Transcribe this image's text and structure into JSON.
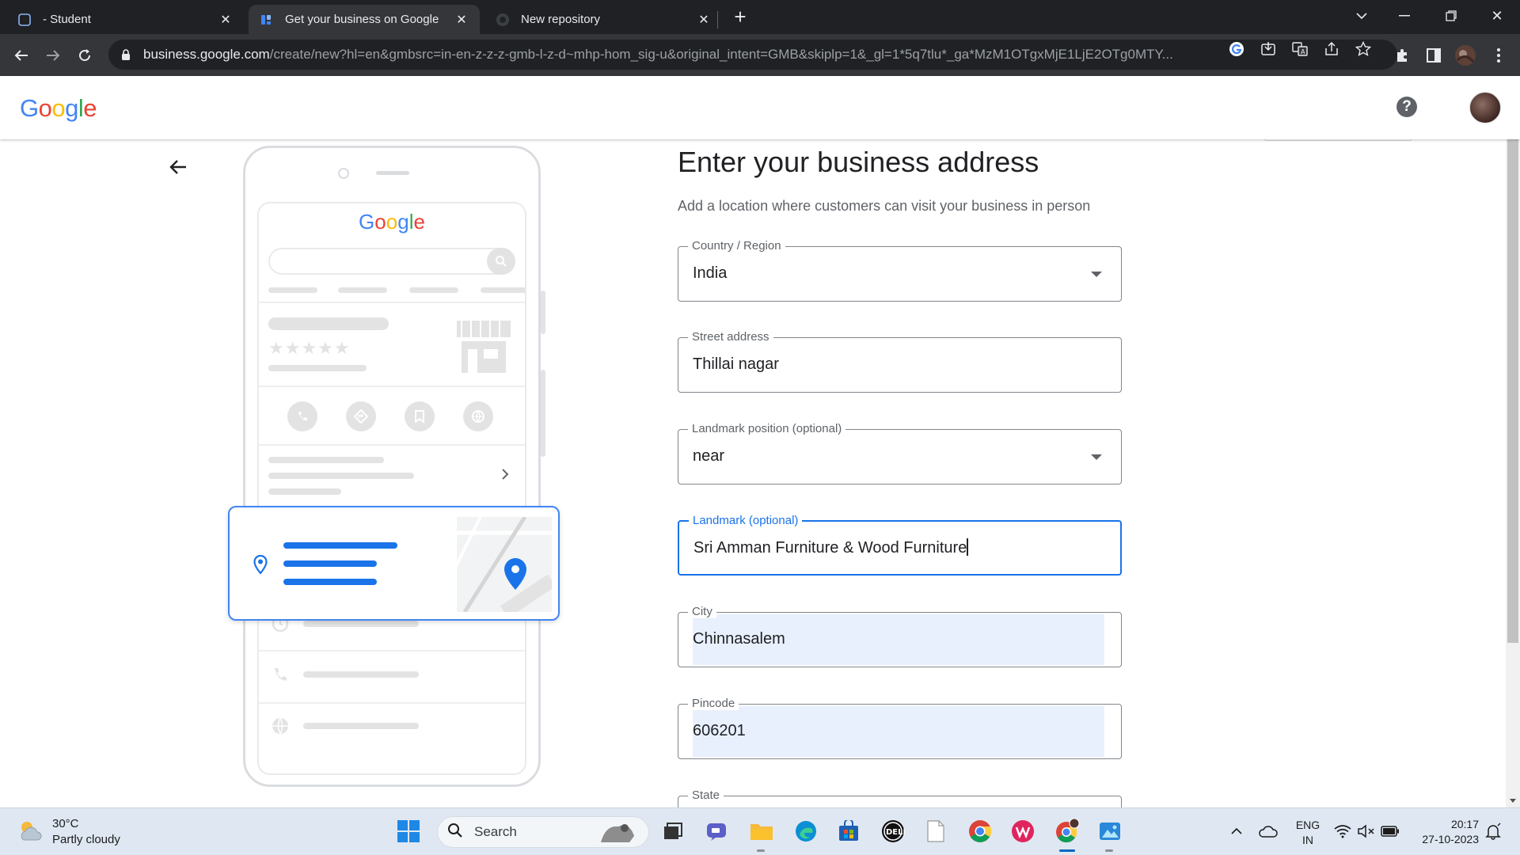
{
  "browser": {
    "tabs": [
      {
        "title": "- Student",
        "active": false
      },
      {
        "title": "Get your business on Google",
        "active": true
      },
      {
        "title": "New repository",
        "active": false
      }
    ],
    "new_tab_label": "+",
    "url_host": "business.google.com",
    "url_path": "/create/new?hl=en&gmbsrc=in-en-z-z-z-gmb-l-z-d~mhp-hom_sig-u&original_intent=GMB&skiplp=1&_gl=1*5q7tlu*_ga*MzM1OTgxMjE1LjE2OTg0MTY..."
  },
  "header": {
    "logo_letters": [
      {
        "ch": "G",
        "color": "#4285F4"
      },
      {
        "ch": "o",
        "color": "#EA4335"
      },
      {
        "ch": "o",
        "color": "#FBBC05"
      },
      {
        "ch": "g",
        "color": "#4285F4"
      },
      {
        "ch": "l",
        "color": "#34A853"
      },
      {
        "ch": "e",
        "color": "#EA4335"
      }
    ],
    "help_label": "?"
  },
  "illustration": {
    "logo_text": "Google",
    "rating_stars": "★★★★★"
  },
  "form": {
    "title": "Enter your business address",
    "subtitle": "Add a location where customers can visit your business in person",
    "fields": [
      {
        "label": "Country / Region",
        "value": "India",
        "type": "dropdown"
      },
      {
        "label": "Street address",
        "value": "Thillai nagar",
        "type": "text"
      },
      {
        "label": "Landmark position (optional)",
        "value": "near",
        "type": "dropdown"
      },
      {
        "label": "Landmark (optional)",
        "value": "Sri Amman Furniture & Wood Furniture",
        "type": "text",
        "focused": true
      },
      {
        "label": "City",
        "value": "Chinnasalem",
        "type": "text",
        "autofilled": true
      },
      {
        "label": "Pincode",
        "value": "606201",
        "type": "text",
        "autofilled": true
      },
      {
        "label": "State",
        "value": "",
        "type": "dropdown"
      }
    ]
  },
  "taskbar": {
    "weather_temp": "30°C",
    "weather_desc": "Partly cloudy",
    "search_label": "Search",
    "lang_top": "ENG",
    "lang_bottom": "IN",
    "time": "20:17",
    "date": "27-10-2023"
  },
  "colors": {
    "accent": "#1a73e8",
    "autofill_bg": "#e8f0fe",
    "chrome_dark": "#202124",
    "chrome_toolbar": "#35363a"
  }
}
